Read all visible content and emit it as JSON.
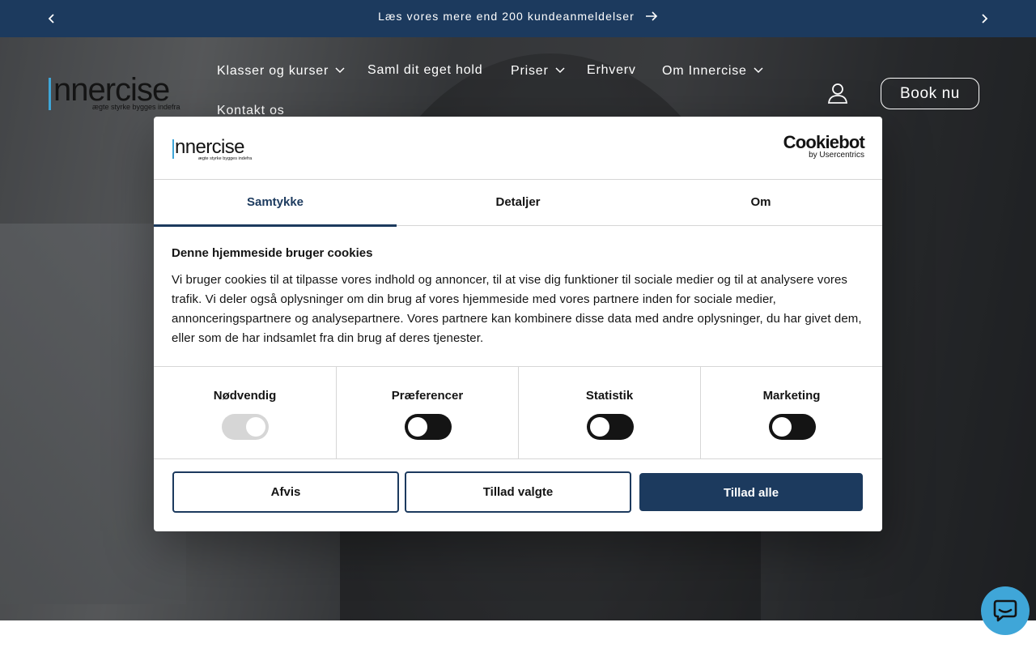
{
  "announcement": {
    "text": "Læs vores mere end 200 kundeanmeldelser"
  },
  "header": {
    "logo_alt": "innercise",
    "logo_tagline": "ægte styrke bygges indefra",
    "nav": [
      {
        "label": "Klasser og kurser",
        "has_dropdown": true
      },
      {
        "label": "Saml dit eget hold",
        "has_dropdown": false
      },
      {
        "label": "Priser",
        "has_dropdown": true
      },
      {
        "label": "Erhverv",
        "has_dropdown": false
      },
      {
        "label": "Om Innercise",
        "has_dropdown": true
      },
      {
        "label": "Kontakt os",
        "has_dropdown": false
      }
    ],
    "book_label": "Book nu"
  },
  "cookie": {
    "brand_main": "Cookiebot",
    "brand_sub": "by Usercentrics",
    "tabs": [
      {
        "label": "Samtykke",
        "active": true
      },
      {
        "label": "Detaljer",
        "active": false
      },
      {
        "label": "Om",
        "active": false
      }
    ],
    "title": "Denne hjemmeside bruger cookies",
    "body": "Vi bruger cookies til at tilpasse vores indhold og annoncer, til at vise dig funktioner til sociale medier og til at analysere vores trafik. Vi deler også oplysninger om din brug af vores hjemmeside med vores partnere inden for sociale medier, annonceringspartnere og analysepartnere. Vores partnere kan kombinere disse data med andre oplysninger, du har givet dem, eller som de har indsamlet fra din brug af deres tjenester.",
    "categories": [
      {
        "label": "Nødvendig",
        "checked": true,
        "disabled": true
      },
      {
        "label": "Præferencer",
        "checked": false,
        "disabled": false
      },
      {
        "label": "Statistik",
        "checked": false,
        "disabled": false
      },
      {
        "label": "Marketing",
        "checked": false,
        "disabled": false
      }
    ],
    "buttons": {
      "deny": "Afvis",
      "allow_selected": "Tillad valgte",
      "allow_all": "Tillad alle"
    }
  },
  "colors": {
    "brand_navy": "#1c3a5e",
    "chat_blue": "#3fa6d8",
    "text_dark": "#141414"
  },
  "icons": {
    "announce_prev": "chevron-left-icon",
    "announce_next": "chevron-right-icon",
    "announce_arrow": "arrow-right-icon",
    "account": "user-icon",
    "chat": "chat-bubble-icon"
  }
}
